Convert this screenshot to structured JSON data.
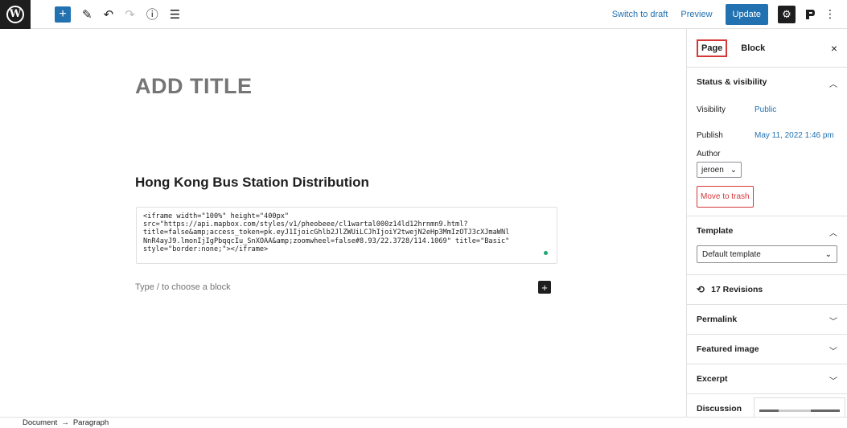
{
  "toolbar": {
    "logo": "W",
    "add_icon": "+",
    "edit_icon": "✎",
    "undo_icon": "↶",
    "redo_icon": "↷",
    "info_icon": "ⓘ",
    "list_icon": "☰",
    "switch_to_draft": "Switch to draft",
    "preview": "Preview",
    "update": "Update",
    "settings_icon": "⚙",
    "more_icon": "⋮"
  },
  "editor": {
    "title_placeholder": "ADD TITLE",
    "heading": "Hong Kong Bus Station Distribution",
    "html_code": "<iframe width=\"100%\" height=\"400px\"\nsrc=\"https://api.mapbox.com/styles/v1/pheobeee/cl1wartal000z14ld12hrnmn9.html?\ntitle=false&amp;access_token=pk.eyJ1IjoicGhlb2JlZWUiLCJhIjoiY2twejN2eHp3MmIzOTJ3cXJmaWNl\nNnR4ayJ9.lmonIjIgPbqqcIu_SnXOAA&amp;zoomwheel=false#8.93/22.3728/114.1069\" title=\"Basic\"\nstyle=\"border:none;\"></iframe>",
    "block_placeholder": "Type / to choose a block",
    "inserter_icon": "+"
  },
  "sidebar": {
    "tab_page": "Page",
    "tab_block": "Block",
    "close_icon": "×",
    "status_title": "Status & visibility",
    "visibility_label": "Visibility",
    "visibility_value": "Public",
    "publish_label": "Publish",
    "publish_value": "May 11, 2022 1:46 pm",
    "author_label": "Author",
    "author_value": "jeroen",
    "move_to_trash": "Move to trash",
    "template_title": "Template",
    "template_value": "Default template",
    "revisions": "17 Revisions",
    "permalink": "Permalink",
    "featured_image": "Featured image",
    "excerpt": "Excerpt",
    "discussion": "Discussion"
  },
  "footer": {
    "breadcrumb_document": "Document",
    "breadcrumb_arrow": "→",
    "breadcrumb_paragraph": "Paragraph"
  },
  "colors": {
    "accent": "#2271b1",
    "danger": "#d63638",
    "dark": "#1e1e1e"
  }
}
